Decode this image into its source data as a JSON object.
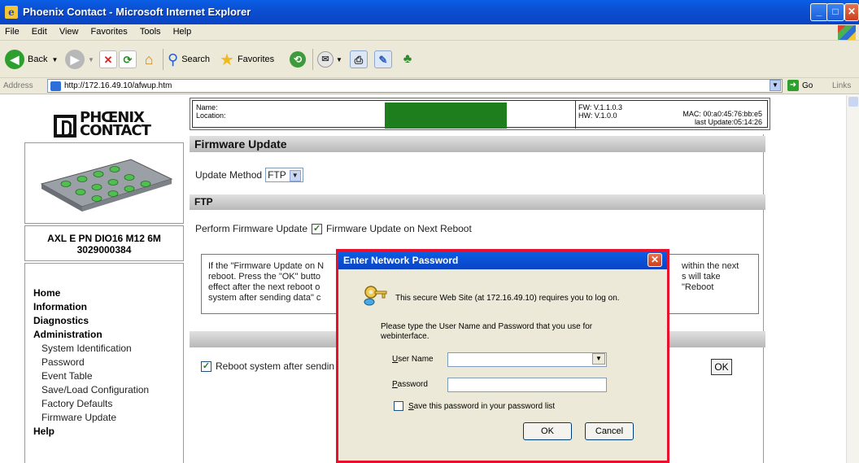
{
  "window": {
    "title": "Phoenix Contact - Microsoft Internet Explorer",
    "app_icon": "ie-icon"
  },
  "menu": [
    "File",
    "Edit",
    "View",
    "Favorites",
    "Tools",
    "Help"
  ],
  "toolbar": {
    "back_label": "Back",
    "search_label": "Search",
    "favorites_label": "Favorites"
  },
  "address": {
    "label": "Address",
    "url": "http://172.16.49.10/afwup.htm",
    "go_label": "Go",
    "links_label": "Links"
  },
  "brand": {
    "logo_line1": "PHŒNIX",
    "logo_line2": "CONTACT"
  },
  "device": {
    "model": "AXL E PN DIO16 M12 6M",
    "part_number": "3029000384",
    "name_label": "Name:",
    "location_label": "Location:",
    "fw": "FW: V.1.1.0.3",
    "hw": "HW: V.1.0.0",
    "mac": "MAC: 00:a0:45:76:bb:e5",
    "last_update": "last Update:05:14:26",
    "status_color": "#1e7e1e"
  },
  "nav": {
    "home": "Home",
    "information": "Information",
    "diagnostics": "Diagnostics",
    "administration": "Administration",
    "sub": [
      "System Identification",
      "Password",
      "Event Table",
      "Save/Load Configuration",
      "Factory Defaults",
      "Firmware Update"
    ],
    "help": "Help"
  },
  "page": {
    "section_title": "Firmware Update",
    "update_method_label": "Update Method",
    "update_method_value": "FTP",
    "ftp_header": "FTP",
    "perform_label": "Perform Firmware Update",
    "perform_option": "Firmware Update on Next Reboot",
    "info_line1_left": "If the \"Firmware Update on N",
    "info_line1_right": "within the next",
    "info_line2_left": "reboot. Press the \"OK\" butto",
    "info_line2_right": "s will take",
    "info_line3_left": "effect after the next reboot o",
    "info_line3_right": "\"Reboot",
    "info_line4_left": "system after sending data\" c",
    "reboot_label": "Reboot system after sendin",
    "ok_label": "OK"
  },
  "dialog": {
    "title": "Enter Network Password",
    "message1": "This secure Web Site (at 172.16.49.10) requires you to log on.",
    "message2": "Please type the User Name and Password that you use for webinterface.",
    "user_label_u": "U",
    "user_label_rest": "ser Name",
    "password_label_u": "P",
    "password_label_rest": "assword",
    "save_label_u": "S",
    "save_label_rest": "ave this password in your password list",
    "ok_label": "OK",
    "cancel_label": "Cancel",
    "highlight_color": "#e8102c"
  }
}
